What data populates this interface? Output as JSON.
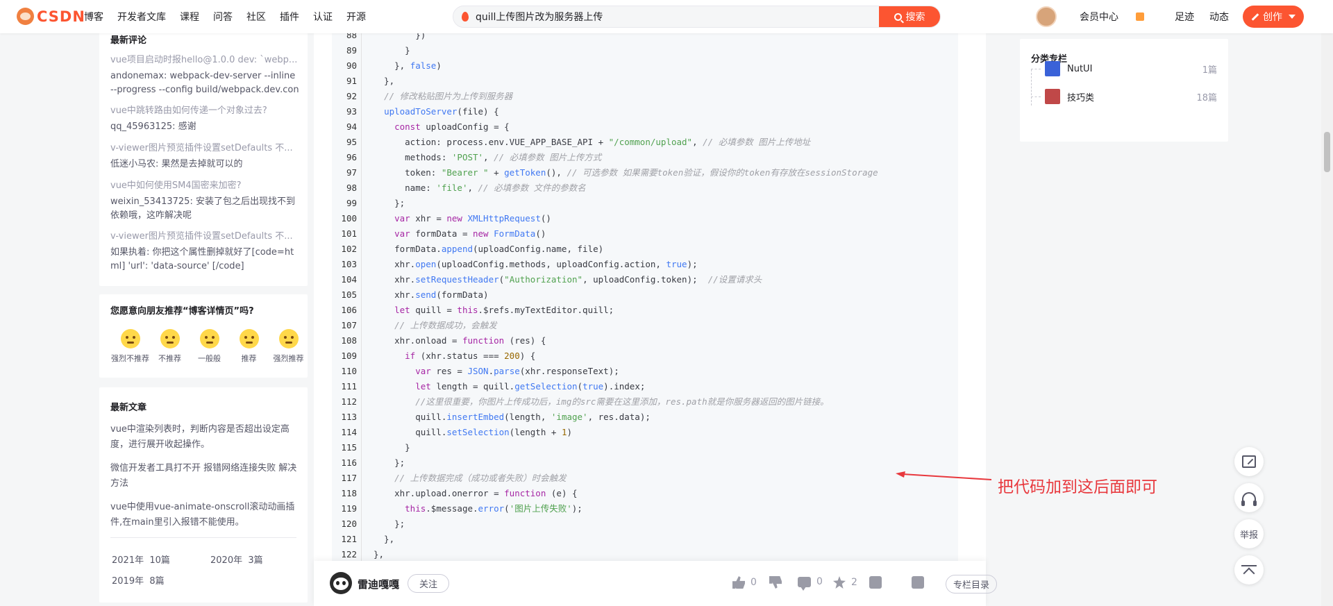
{
  "header": {
    "logo_text": "CSDN",
    "nav": [
      "博客",
      "开发者文库",
      "课程",
      "问答",
      "社区",
      "插件",
      "认证",
      "开源"
    ],
    "search_value": "quill上传图片改为服务器上传",
    "search_button": "搜索",
    "right_links": [
      "会员中心",
      "足迹",
      "动态",
      "消息"
    ],
    "create_button": "创作"
  },
  "left": {
    "comments_title": "最新评论",
    "comments": [
      {
        "q": "vue项目启动时报hello@1.0.0 dev: `webp...",
        "a": "andonemax: webpack-dev-server --inline --progress --config build/webpack.dev.conf..."
      },
      {
        "q": "vue中跳转路由如何传递一个对象过去?",
        "a": "qq_45963125: 感谢"
      },
      {
        "q": "v-viewer图片预览插件设置setDefaults 不...",
        "a": "低迷小马农: 果然是去掉就可以的"
      },
      {
        "q": "vue中如何使用SM4国密来加密?",
        "a": "weixin_53413725: 安装了包之后出现找不到依赖哦，这咋解决呢"
      },
      {
        "q": "v-viewer图片预览插件设置setDefaults 不...",
        "a": "如果执着: 你把这个属性删掉就好了[code=html] 'url': 'data-source' [/code]"
      }
    ],
    "recommend_title": "您愿意向朋友推荐“博客详情页”吗?",
    "recommend_options": [
      "强烈不推荐",
      "不推荐",
      "一般般",
      "推荐",
      "强烈推荐"
    ],
    "articles_title": "最新文章",
    "articles": [
      "vue中渲染列表时，判断内容是否超出设定高度，进行展开收起操作。",
      "微信开发者工具打不开 报错网络连接失败 解决方法",
      "vue中使用vue-animate-onscroll滚动动画插件,在main里引入报错不能使用。"
    ],
    "archive": [
      {
        "year": "2021年",
        "count": "10篇"
      },
      {
        "year": "2020年",
        "count": "3篇"
      },
      {
        "year": "2019年",
        "count": "8篇"
      }
    ]
  },
  "code": {
    "line_numbers": [
      "88",
      "89",
      "90",
      "91",
      "92",
      "93",
      "94",
      "95",
      "96",
      "97",
      "98",
      "99",
      "100",
      "101",
      "102",
      "103",
      "104",
      "105",
      "106",
      "107",
      "108",
      "109",
      "110",
      "111",
      "112",
      "113",
      "114",
      "115",
      "116",
      "117",
      "118",
      "119",
      "120",
      "121",
      "122"
    ],
    "annotation": "把代码加到这后面即可"
  },
  "toolbar": {
    "author": "雷迪嘎嘎",
    "follow": "关注",
    "like_count": "0",
    "comment_count": "0",
    "star_count": "2",
    "column_button": "专栏目录"
  },
  "right": {
    "columns_title": "分类专栏",
    "columns": [
      {
        "name": "NutUI",
        "count": "1篇",
        "color": "#3a62d8"
      },
      {
        "name": "技巧类",
        "count": "18篇",
        "color": "#c04848"
      }
    ]
  },
  "side": {
    "report_label": "举报"
  }
}
